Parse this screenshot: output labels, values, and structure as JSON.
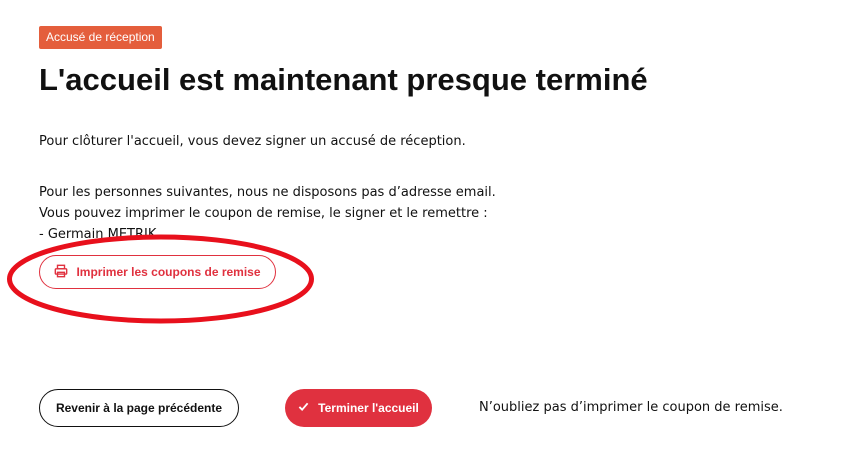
{
  "badge": {
    "label": "Accusé de réception"
  },
  "heading": {
    "title": "L'accueil est maintenant presque terminé"
  },
  "intro": {
    "text": "Pour clôturer l'accueil, vous devez signer un accusé de réception."
  },
  "no_email": {
    "line1": "Pour les personnes suivantes, nous ne disposons pas d’adresse email.",
    "line2": "Vous pouvez imprimer le coupon de remise, le signer et le remettre :",
    "persons": [
      "- Germain METRIK"
    ]
  },
  "print_button": {
    "label": "Imprimer les coupons de remise",
    "icon": "printer-icon"
  },
  "footer": {
    "back_label": "Revenir à la page précédente",
    "finish_label": "Terminer l'accueil",
    "finish_icon": "check-icon",
    "reminder": "N’oubliez pas d’imprimer le coupon de remise."
  },
  "colors": {
    "accent": "#e0313f",
    "badge": "#e45e3c",
    "annotation": "#e8101c"
  }
}
